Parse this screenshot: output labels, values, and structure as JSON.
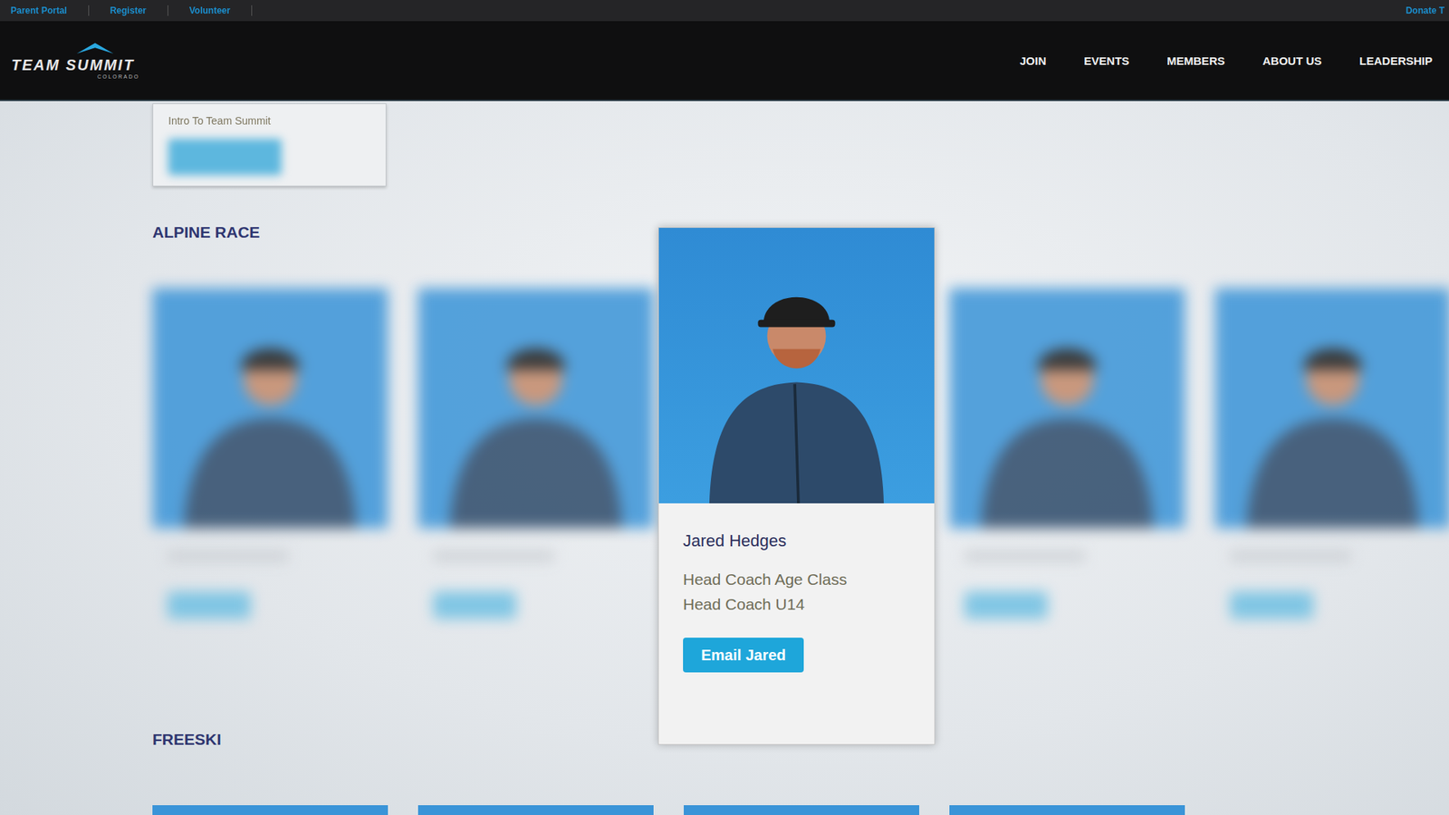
{
  "utility_bar": {
    "links": [
      "Parent Portal",
      "Register",
      "Volunteer"
    ],
    "right_link": "Donate T"
  },
  "logo": {
    "title": "TEAM SUMMIT",
    "subtitle": "COLORADO"
  },
  "nav": {
    "items": [
      "JOIN",
      "EVENTS",
      "MEMBERS",
      "ABOUT US",
      "LEADERSHIP"
    ]
  },
  "intro_box": {
    "label": "Intro To Team Summit"
  },
  "sections": [
    {
      "title": "ALPINE RACE",
      "cards": [
        {
          "focused": false,
          "blurred": true
        },
        {
          "focused": false,
          "blurred": true
        },
        {
          "focused": true,
          "blurred": false,
          "name": "Jared Hedges",
          "roles": [
            "Head Coach Age Class",
            "Head Coach U14"
          ],
          "button": "Email Jared"
        },
        {
          "focused": false,
          "blurred": true
        },
        {
          "focused": false,
          "blurred": true
        }
      ]
    },
    {
      "title": "FREESKI",
      "cards": [
        {
          "focused": false,
          "blurred": false
        },
        {
          "focused": false,
          "blurred": false
        },
        {
          "focused": false,
          "blurred": false
        },
        {
          "focused": false,
          "blurred": false
        }
      ]
    }
  ]
}
